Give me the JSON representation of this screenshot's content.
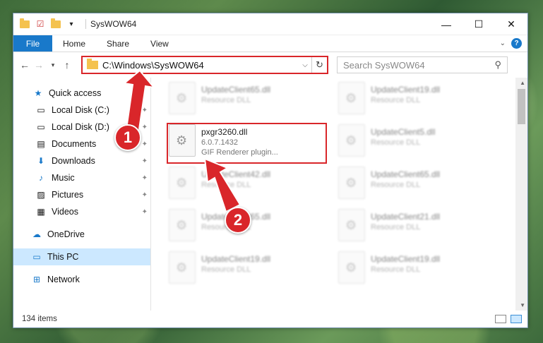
{
  "window": {
    "title": "SysWOW64",
    "controls": {
      "minimize": "—",
      "maximize": "☐",
      "close": "✕"
    }
  },
  "ribbon": {
    "file_tab": "File",
    "tabs": [
      "Home",
      "Share",
      "View"
    ]
  },
  "address": {
    "path": "C:\\Windows\\SysWOW64",
    "search_placeholder": "Search SysWOW64"
  },
  "navpane": {
    "quick_access": "Quick access",
    "items": [
      {
        "label": "Local Disk (C:)",
        "icon": "drive-icon",
        "pinned": true
      },
      {
        "label": "Local Disk (D:)",
        "icon": "drive-icon",
        "pinned": true
      },
      {
        "label": "Documents",
        "icon": "documents-icon",
        "pinned": true
      },
      {
        "label": "Downloads",
        "icon": "downloads-icon",
        "pinned": true
      },
      {
        "label": "Music",
        "icon": "music-icon",
        "pinned": true
      },
      {
        "label": "Pictures",
        "icon": "pictures-icon",
        "pinned": true
      },
      {
        "label": "Videos",
        "icon": "videos-icon",
        "pinned": true
      }
    ],
    "onedrive": "OneDrive",
    "thispc": "This PC",
    "network": "Network"
  },
  "files": {
    "highlighted": {
      "name": "pxgr3260.dll",
      "version": "6.0.7.1432",
      "desc": "GIF Renderer plugin..."
    },
    "blurred": [
      {
        "name": "UpdateClient65.dll",
        "desc": "Resource DLL"
      },
      {
        "name": "UpdateClient19.dll",
        "desc": "Resource DLL"
      },
      {
        "name": "UpdateClient5.dll",
        "desc": "Resource DLL"
      },
      {
        "name": "UpdateClient42.dll",
        "desc": "Resource DLL"
      },
      {
        "name": "UpdateClient65.dll",
        "desc": "Resource DLL"
      },
      {
        "name": "UpdateClient65.dll",
        "desc": "Resource DLL"
      },
      {
        "name": "UpdateClient21.dll",
        "desc": "Resource DLL"
      },
      {
        "name": "UpdateClient19.dll",
        "desc": "Resource DLL"
      },
      {
        "name": "UpdateClient19.dll",
        "desc": "Resource DLL"
      }
    ]
  },
  "status": {
    "item_count": "134 items"
  },
  "annotations": {
    "step1": "1",
    "step2": "2"
  },
  "colors": {
    "accent": "#1979ca",
    "highlight": "#d9262a",
    "selected": "#cce8ff"
  }
}
